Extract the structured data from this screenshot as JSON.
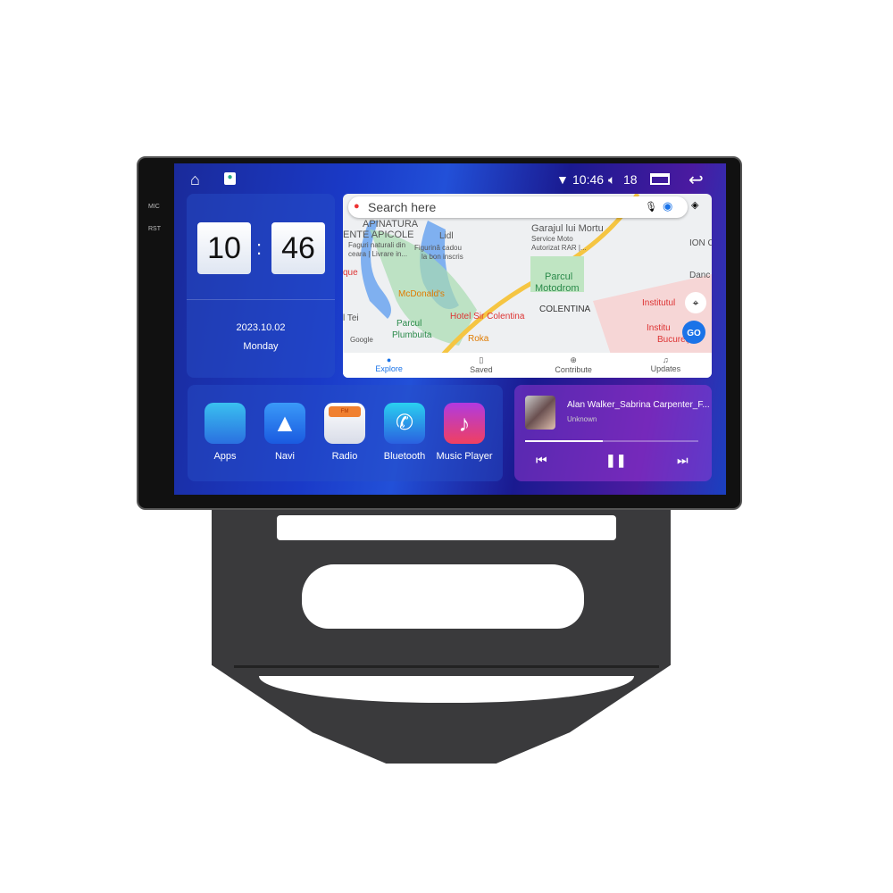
{
  "hardware": {
    "mic": "MIC",
    "rst": "RST"
  },
  "status": {
    "time": "10:46",
    "volume": "18"
  },
  "clock": {
    "hour": "10",
    "minute": "46",
    "separator": ":",
    "date": "2023.10.02",
    "weekday": "Monday"
  },
  "map": {
    "search_placeholder": "Search here",
    "labels": [
      "APINATURA",
      "ENTE APICOLE",
      "Faguri naturali din",
      "ceara | Livrare in...",
      "Lidl",
      "Figurină cadou",
      "la bon inscris",
      "Garajul lui Mortu",
      "Service Moto",
      "Autorizat RAR |...",
      "ION C",
      "que",
      "Danc",
      "McDonald's",
      "Parcul",
      "Motodrom",
      "COLENTINA",
      "Institutul",
      "l Tei",
      "Parcul",
      "Plumbuita",
      "Hotel Sir Colentina",
      "Roka",
      "Institu",
      "Bucureș",
      "Google",
      "GO"
    ],
    "tabs": [
      "Explore",
      "Saved",
      "Contribute",
      "Updates"
    ]
  },
  "apps": [
    {
      "label": "Apps",
      "icon": "apps-grid-icon"
    },
    {
      "label": "Navi",
      "icon": "navigation-arrow-icon"
    },
    {
      "label": "Radio",
      "icon": "radio-fm-icon",
      "badge": "FM"
    },
    {
      "label": "Bluetooth",
      "icon": "bluetooth-phone-icon"
    },
    {
      "label": "Music Player",
      "icon": "music-note-icon"
    }
  ],
  "music": {
    "title": "Alan Walker_Sabrina Carpenter_F...",
    "artist": "Unknown",
    "progress_percent": 45
  }
}
